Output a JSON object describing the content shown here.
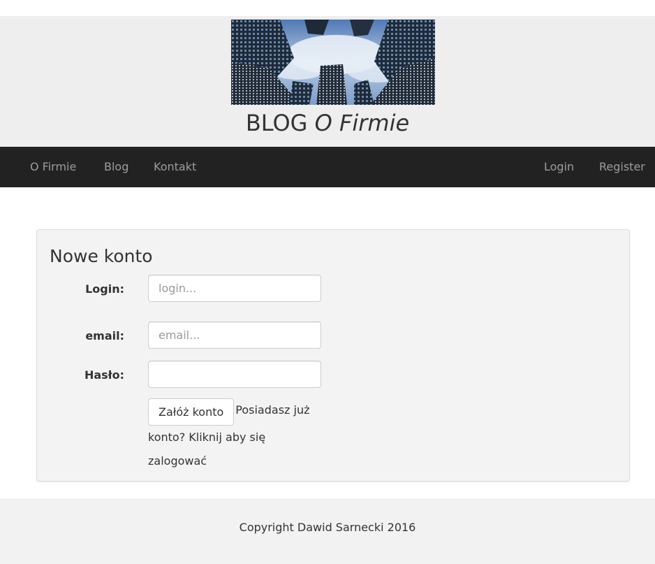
{
  "header": {
    "image_alt": "skyscrapers looking up",
    "brand_plain": "BLOG ",
    "brand_italic": "O Firmie"
  },
  "navbar": {
    "left_items": [
      "O Firmie",
      "Blog",
      "Kontakt"
    ],
    "right_items": [
      "Login",
      "Register"
    ]
  },
  "form": {
    "title": "Nowe konto",
    "login_label": "Login:",
    "login_placeholder": "login...",
    "email_label": "email:",
    "email_placeholder": "email...",
    "password_label": "Hasło:",
    "password_value": "",
    "submit_label": "Załóż konto",
    "login_prompt": "Posiadasz już konto? Kliknij aby się zalogować"
  },
  "footer": {
    "copyright": "Copyright Dawid Sarnecki 2016"
  },
  "colors": {
    "header_bg": "#eeeeee",
    "navbar_bg": "#222222",
    "nav_link": "#9d9d9d",
    "panel_bg": "#f3f3f3",
    "footer_bg": "#f2f2f2"
  }
}
